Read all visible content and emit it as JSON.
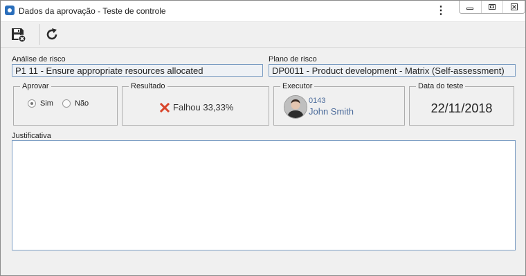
{
  "window": {
    "title": "Dados da aprovação - Teste de controle",
    "icons": {
      "app": "app-logo-icon",
      "menu": "kebab-menu-icon",
      "minimize": "minimize-icon",
      "maximize": "maximize-icon",
      "close": "close-icon"
    }
  },
  "toolbar": {
    "icons": {
      "save_close": "save-close-icon",
      "refresh": "refresh-icon"
    }
  },
  "risk_analysis": {
    "label": "Análise de risco",
    "value": "P1 11 - Ensure appropriate resources allocated"
  },
  "risk_plan": {
    "label": "Plano de risco",
    "value": "DP0011 - Product development - Matrix (Self-assessment)"
  },
  "approve": {
    "legend": "Aprovar",
    "options": [
      {
        "label": "Sim",
        "checked": true
      },
      {
        "label": "Não",
        "checked": false
      }
    ]
  },
  "result": {
    "legend": "Resultado",
    "text": "Falhou 33,33%",
    "status_color": "#d9452b"
  },
  "executor": {
    "legend": "Executor",
    "code": "0143",
    "name": "John Smith",
    "color": "#4a6a9a"
  },
  "test_date": {
    "legend": "Data do teste",
    "value": "22/11/2018"
  },
  "justification": {
    "label": "Justificativa",
    "value": ""
  }
}
